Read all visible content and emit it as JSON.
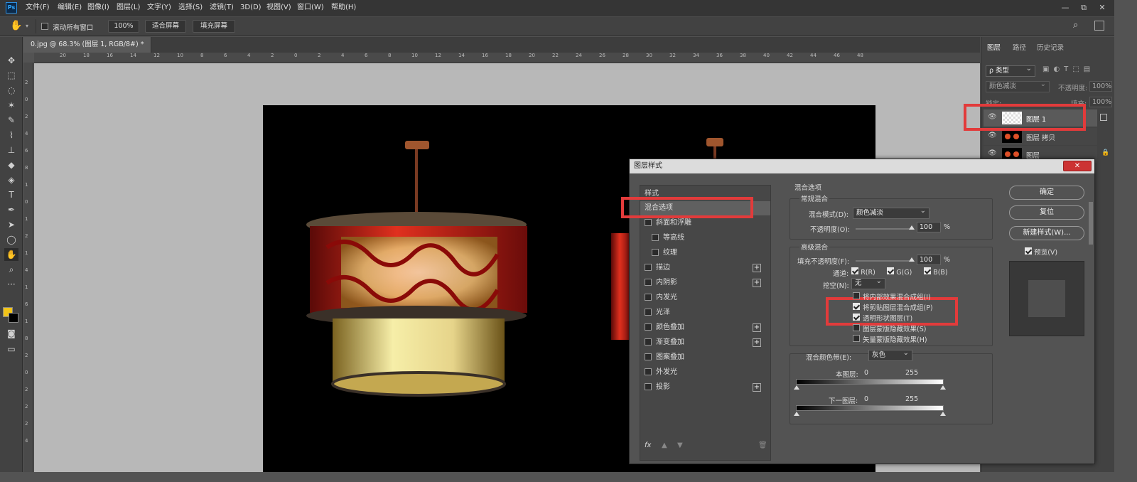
{
  "app": {
    "logo": "Ps",
    "menu": [
      "文件(F)",
      "编辑(E)",
      "图像(I)",
      "图层(L)",
      "文字(Y)",
      "选择(S)",
      "滤镜(T)",
      "3D(D)",
      "视图(V)",
      "窗口(W)",
      "帮助(H)"
    ]
  },
  "window_controls": [
    "—",
    "⧉",
    "✕"
  ],
  "options": {
    "scroll_all": "滚动所有窗口",
    "zoom": "100%",
    "fit_screen": "适合屏幕",
    "fill_screen": "填充屏幕"
  },
  "doc_tab": {
    "title": "0.jpg @ 68.3% (图层 1, RGB/8#) *",
    "close": "×"
  },
  "ruler_top": [
    "20",
    "18",
    "16",
    "14",
    "12",
    "10",
    "8",
    "6",
    "4",
    "2",
    "0",
    "2",
    "4",
    "6",
    "8",
    "10",
    "12",
    "14",
    "16",
    "18",
    "20",
    "22",
    "24",
    "26",
    "28",
    "30",
    "32",
    "34",
    "36",
    "38",
    "40",
    "42",
    "44",
    "46",
    "48"
  ],
  "ruler_left": [
    "2",
    "0",
    "2",
    "4",
    "6",
    "8",
    "1",
    "0",
    "1",
    "2",
    "1",
    "4",
    "1",
    "6",
    "1",
    "8",
    "2",
    "0",
    "2",
    "2",
    "2",
    "4"
  ],
  "layers_panel": {
    "tabs": [
      "图层",
      "路径",
      "历史记录"
    ],
    "filter_label": "ρ 类型",
    "blend_mode": "颜色减淡",
    "opacity_label": "不透明度:",
    "opacity_value": "100%",
    "lock_label": "锁定:",
    "fill_label": "填充:",
    "fill_value": "100%",
    "layers": [
      {
        "name": "图层 1"
      },
      {
        "name": "图层 拷贝"
      },
      {
        "name": "图层"
      }
    ]
  },
  "dialog": {
    "title": "图层样式",
    "close": "✕",
    "styles_header": "样式",
    "styles": [
      {
        "label": "混合选项",
        "checkbox": false,
        "plus": false
      },
      {
        "label": "斜面和浮雕",
        "checkbox": true,
        "plus": false
      },
      {
        "label": "等高线",
        "checkbox": true,
        "plus": false,
        "indent": true
      },
      {
        "label": "纹理",
        "checkbox": true,
        "plus": false,
        "indent": true
      },
      {
        "label": "描边",
        "checkbox": true,
        "plus": true
      },
      {
        "label": "内阴影",
        "checkbox": true,
        "plus": true
      },
      {
        "label": "内发光",
        "checkbox": true,
        "plus": false
      },
      {
        "label": "光泽",
        "checkbox": true,
        "plus": false
      },
      {
        "label": "颜色叠加",
        "checkbox": true,
        "plus": true
      },
      {
        "label": "渐变叠加",
        "checkbox": true,
        "plus": true
      },
      {
        "label": "图案叠加",
        "checkbox": true,
        "plus": false
      },
      {
        "label": "外发光",
        "checkbox": true,
        "plus": false
      },
      {
        "label": "投影",
        "checkbox": true,
        "plus": true
      }
    ],
    "fx": "fx",
    "blend_section": "混合选项",
    "general_blend": "常规混合",
    "blend_mode_label": "混合模式(D):",
    "blend_mode_value": "颜色减淡",
    "opacity_label": "不透明度(O):",
    "opacity_value": "100",
    "pct": "%",
    "advanced_blend": "高级混合",
    "fill_opacity_label": "填充不透明度(F):",
    "fill_opacity_value": "100",
    "channels_label": "通道:",
    "channels": [
      "R(R)",
      "G(G)",
      "B(B)"
    ],
    "knockout_label": "挖空(N):",
    "knockout_value": "无",
    "options": [
      {
        "label": "将内部效果混合成组(I)",
        "checked": false
      },
      {
        "label": "将剪贴图层混合成组(P)",
        "checked": true
      },
      {
        "label": "透明形状图层(T)",
        "checked": true
      },
      {
        "label": "图层蒙版隐藏效果(S)",
        "checked": false
      },
      {
        "label": "矢量蒙版隐藏效果(H)",
        "checked": false
      }
    ],
    "blend_if_label": "混合颜色带(E):",
    "blend_if_value": "灰色",
    "this_layer_label": "本图层:",
    "this_layer_min": "0",
    "this_layer_max": "255",
    "underlying_label": "下一图层:",
    "underlying_min": "0",
    "underlying_max": "255",
    "ok": "确定",
    "reset": "复位",
    "new_style": "新建样式(W)...",
    "preview": "预览(V)"
  },
  "colors": {
    "highlight": "#e23b3b",
    "fg_swatch": "#f2c418",
    "bg_swatch": "#000000"
  }
}
